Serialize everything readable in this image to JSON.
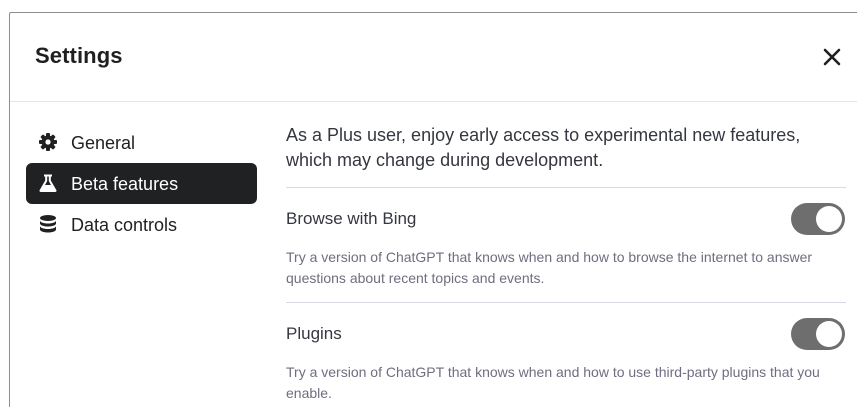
{
  "header": {
    "title": "Settings"
  },
  "sidebar": {
    "items": [
      {
        "label": "General",
        "icon": "gear-icon",
        "active": false
      },
      {
        "label": "Beta features",
        "icon": "flask-icon",
        "active": true
      },
      {
        "label": "Data controls",
        "icon": "database-icon",
        "active": false
      }
    ]
  },
  "content": {
    "intro": "As a Plus user, enjoy early access to experimental new features, which may change during development.",
    "features": [
      {
        "title": "Browse with Bing",
        "description": "Try a version of ChatGPT that knows when and how to browse the internet to answer questions about recent topics and events.",
        "enabled": true
      },
      {
        "title": "Plugins",
        "description": "Try a version of ChatGPT that knows when and how to use third-party plugins that you enable.",
        "enabled": true
      }
    ]
  },
  "colors": {
    "active_nav_bg": "#202123",
    "toggle_on": "#6e6e6e"
  }
}
